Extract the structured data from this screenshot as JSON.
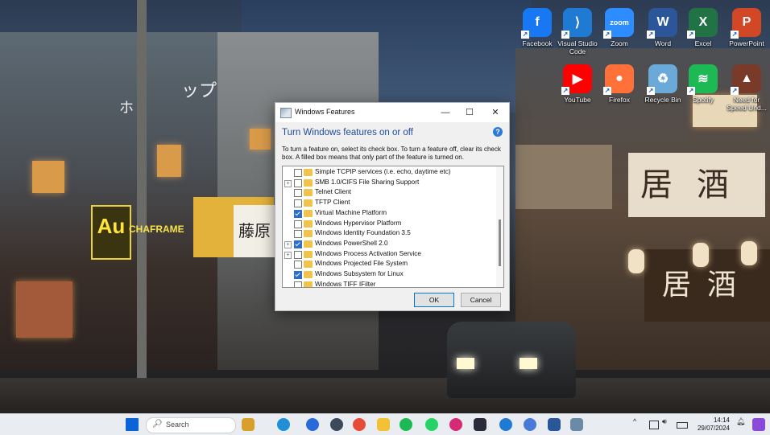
{
  "wallpaper": {
    "sign_left_katakana": "ップ",
    "sign_left_ho": "ホ",
    "sign_au": "Au",
    "sign_chaframe": "CHAFRAME",
    "sign_kanji_big": "居酒",
    "sign_kanji_big2": "居酒",
    "sign_tofu": "藤原"
  },
  "desktop_icons": [
    {
      "label": "Facebook",
      "icon": "facebook-icon",
      "color": "#1877f2",
      "glyph": "f"
    },
    {
      "label": "Visual Studio Code",
      "icon": "vscode-icon",
      "color": "#1f7ad3",
      "glyph": "⟩"
    },
    {
      "label": "Zoom",
      "icon": "zoom-icon",
      "color": "#2d8cff",
      "glyph": "zoom"
    },
    {
      "label": "Word",
      "icon": "word-icon",
      "color": "#2b579a",
      "glyph": "W"
    },
    {
      "label": "Excel",
      "icon": "excel-icon",
      "color": "#217346",
      "glyph": "X"
    },
    {
      "label": "PowerPoint",
      "icon": "powerpoint-icon",
      "color": "#d24726",
      "glyph": "P"
    },
    {
      "label": "YouTube",
      "icon": "youtube-icon",
      "color": "#ff0000",
      "glyph": "▶"
    },
    {
      "label": "Firefox",
      "icon": "firefox-icon",
      "color": "#ff7139",
      "glyph": "●"
    },
    {
      "label": "Recycle Bin",
      "icon": "recycle-bin-icon",
      "color": "#6aa9d8",
      "glyph": "♻"
    },
    {
      "label": "Spotify",
      "icon": "spotify-icon",
      "color": "#1db954",
      "glyph": "≋"
    },
    {
      "label": "Need for Speed Und...",
      "icon": "need-for-speed-icon",
      "color": "#7a3a2a",
      "glyph": "▲"
    }
  ],
  "dialog": {
    "title": "Windows Features",
    "minimize": "—",
    "maximize": "☐",
    "close": "✕",
    "heading": "Turn Windows features on or off",
    "help": "?",
    "description": "To turn a feature on, select its check box. To turn a feature off, clear its check box. A filled box means that only part of the feature is turned on.",
    "features": [
      {
        "label": "Simple TCPIP services (i.e. echo, daytime etc)",
        "checked": false,
        "expandable": false
      },
      {
        "label": "SMB 1.0/CIFS File Sharing Support",
        "checked": false,
        "expandable": true
      },
      {
        "label": "Telnet Client",
        "checked": false,
        "expandable": false
      },
      {
        "label": "TFTP Client",
        "checked": false,
        "expandable": false
      },
      {
        "label": "Virtual Machine Platform",
        "checked": true,
        "expandable": false
      },
      {
        "label": "Windows Hypervisor Platform",
        "checked": false,
        "expandable": false
      },
      {
        "label": "Windows Identity Foundation 3.5",
        "checked": false,
        "expandable": false
      },
      {
        "label": "Windows PowerShell 2.0",
        "checked": true,
        "expandable": true
      },
      {
        "label": "Windows Process Activation Service",
        "checked": false,
        "expandable": true
      },
      {
        "label": "Windows Projected File System",
        "checked": false,
        "expandable": false
      },
      {
        "label": "Windows Subsystem for Linux",
        "checked": true,
        "expandable": false
      },
      {
        "label": "Windows TIFF IFilter",
        "checked": false,
        "expandable": false
      }
    ],
    "ok_label": "OK",
    "cancel_label": "Cancel"
  },
  "taskbar": {
    "search_placeholder": "Search",
    "apps": [
      {
        "icon": "windows-start-icon",
        "color": "#0a64d8"
      },
      {
        "icon": "widgets-icon",
        "color": "#d8a02a"
      },
      {
        "icon": "edge-icon",
        "color": "#1f8fd8"
      },
      {
        "icon": "store-icon",
        "color": "#2a6ad8"
      },
      {
        "icon": "camera-icon",
        "color": "#3a4a5a"
      },
      {
        "icon": "chrome-icon",
        "color": "#e84a3a"
      },
      {
        "icon": "file-explorer-icon",
        "color": "#f2c234"
      },
      {
        "icon": "spotify-icon",
        "color": "#1db954"
      },
      {
        "icon": "spotify-icon",
        "color": "#1db954"
      },
      {
        "icon": "whatsapp-icon",
        "color": "#25d366"
      },
      {
        "icon": "instagram-icon",
        "color": "#d62976"
      },
      {
        "icon": "terminal-icon",
        "color": "#2a2a3a"
      },
      {
        "icon": "vscode-icon",
        "color": "#1f7ad3"
      },
      {
        "icon": "chrome-alt-icon",
        "color": "#4a7ad8"
      },
      {
        "icon": "word-icon",
        "color": "#2b579a"
      },
      {
        "icon": "notepad-icon",
        "color": "#6a8aa8"
      }
    ],
    "tray_chevron": "^",
    "time": "14:14",
    "date": "29/07/2024"
  }
}
